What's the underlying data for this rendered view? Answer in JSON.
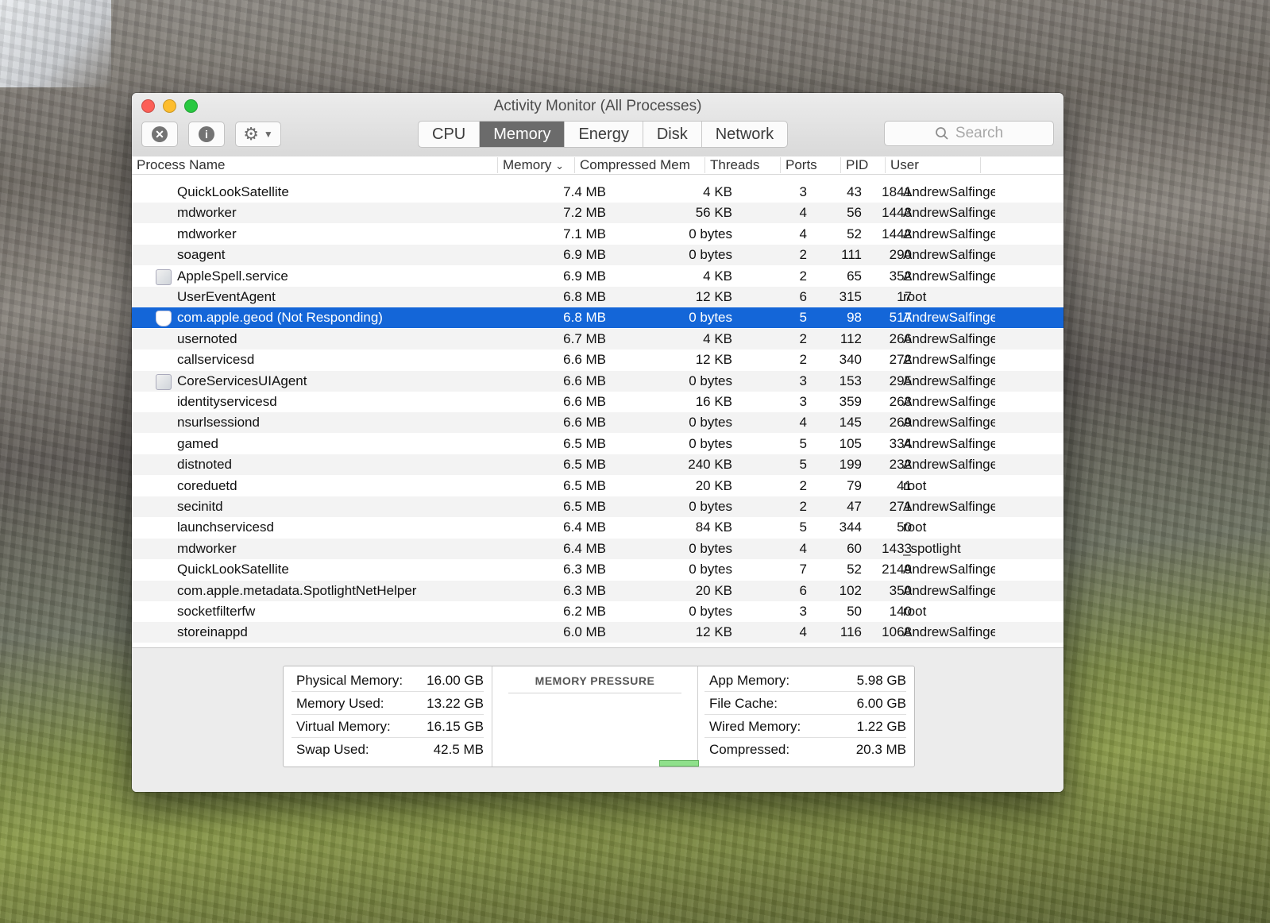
{
  "window": {
    "title": "Activity Monitor (All Processes)"
  },
  "toolbar": {
    "stop_icon": "close-x-icon",
    "info_icon": "info-icon",
    "gear_icon": "gear-icon",
    "tabs": [
      "CPU",
      "Memory",
      "Energy",
      "Disk",
      "Network"
    ],
    "active_tab": "Memory",
    "search_placeholder": "Search"
  },
  "table": {
    "columns": [
      "Process Name",
      "Memory",
      "Compressed Mem",
      "Threads",
      "Ports",
      "PID",
      "User"
    ],
    "sort_indicator": "⌄",
    "rows": [
      {
        "name": "QuickLookSatellite",
        "memory": "7.4 MB",
        "compressed": "4 KB",
        "threads": "3",
        "ports": "43",
        "pid": "1841",
        "user": "AndrewSalfinge"
      },
      {
        "name": "mdworker",
        "memory": "7.2 MB",
        "compressed": "56 KB",
        "threads": "4",
        "ports": "56",
        "pid": "1443",
        "user": "AndrewSalfinge"
      },
      {
        "name": "mdworker",
        "memory": "7.1 MB",
        "compressed": "0 bytes",
        "threads": "4",
        "ports": "52",
        "pid": "1442",
        "user": "AndrewSalfinge"
      },
      {
        "name": "soagent",
        "memory": "6.9 MB",
        "compressed": "0 bytes",
        "threads": "2",
        "ports": "111",
        "pid": "290",
        "user": "AndrewSalfinge"
      },
      {
        "name": "AppleSpell.service",
        "memory": "6.9 MB",
        "compressed": "4 KB",
        "threads": "2",
        "ports": "65",
        "pid": "352",
        "user": "AndrewSalfinge"
      },
      {
        "name": "UserEventAgent",
        "memory": "6.8 MB",
        "compressed": "12 KB",
        "threads": "6",
        "ports": "315",
        "pid": "17",
        "user": "root"
      },
      {
        "name": "com.apple.geod (Not Responding)",
        "memory": "6.8 MB",
        "compressed": "0 bytes",
        "threads": "5",
        "ports": "98",
        "pid": "517",
        "user": "AndrewSalfinge"
      },
      {
        "name": "usernoted",
        "memory": "6.7 MB",
        "compressed": "4 KB",
        "threads": "2",
        "ports": "112",
        "pid": "266",
        "user": "AndrewSalfinge"
      },
      {
        "name": "callservicesd",
        "memory": "6.6 MB",
        "compressed": "12 KB",
        "threads": "2",
        "ports": "340",
        "pid": "272",
        "user": "AndrewSalfinge"
      },
      {
        "name": "CoreServicesUIAgent",
        "memory": "6.6 MB",
        "compressed": "0 bytes",
        "threads": "3",
        "ports": "153",
        "pid": "295",
        "user": "AndrewSalfinge"
      },
      {
        "name": "identityservicesd",
        "memory": "6.6 MB",
        "compressed": "16 KB",
        "threads": "3",
        "ports": "359",
        "pid": "263",
        "user": "AndrewSalfinge"
      },
      {
        "name": "nsurlsessiond",
        "memory": "6.6 MB",
        "compressed": "0 bytes",
        "threads": "4",
        "ports": "145",
        "pid": "269",
        "user": "AndrewSalfinge"
      },
      {
        "name": "gamed",
        "memory": "6.5 MB",
        "compressed": "0 bytes",
        "threads": "5",
        "ports": "105",
        "pid": "334",
        "user": "AndrewSalfinge"
      },
      {
        "name": "distnoted",
        "memory": "6.5 MB",
        "compressed": "240 KB",
        "threads": "5",
        "ports": "199",
        "pid": "232",
        "user": "AndrewSalfinge"
      },
      {
        "name": "coreduetd",
        "memory": "6.5 MB",
        "compressed": "20 KB",
        "threads": "2",
        "ports": "79",
        "pid": "41",
        "user": "root"
      },
      {
        "name": "secinitd",
        "memory": "6.5 MB",
        "compressed": "0 bytes",
        "threads": "2",
        "ports": "47",
        "pid": "271",
        "user": "AndrewSalfinge"
      },
      {
        "name": "launchservicesd",
        "memory": "6.4 MB",
        "compressed": "84 KB",
        "threads": "5",
        "ports": "344",
        "pid": "50",
        "user": "root"
      },
      {
        "name": "mdworker",
        "memory": "6.4 MB",
        "compressed": "0 bytes",
        "threads": "4",
        "ports": "60",
        "pid": "1433",
        "user": "_spotlight"
      },
      {
        "name": "QuickLookSatellite",
        "memory": "6.3 MB",
        "compressed": "0 bytes",
        "threads": "7",
        "ports": "52",
        "pid": "2149",
        "user": "AndrewSalfinge"
      },
      {
        "name": "com.apple.metadata.SpotlightNetHelper",
        "memory": "6.3 MB",
        "compressed": "20 KB",
        "threads": "6",
        "ports": "102",
        "pid": "350",
        "user": "AndrewSalfinge"
      },
      {
        "name": "socketfilterfw",
        "memory": "6.2 MB",
        "compressed": "0 bytes",
        "threads": "3",
        "ports": "50",
        "pid": "140",
        "user": "root"
      },
      {
        "name": "storeinappd",
        "memory": "6.0 MB",
        "compressed": "12 KB",
        "threads": "4",
        "ports": "116",
        "pid": "1068",
        "user": "AndrewSalfinge"
      }
    ],
    "selected_index": 6,
    "icon_rows": {
      "4": "doc",
      "6": "shield",
      "9": "doc"
    }
  },
  "stats": {
    "left": [
      {
        "label": "Physical Memory:",
        "value": "16.00 GB"
      },
      {
        "label": "Memory Used:",
        "value": "13.22 GB"
      },
      {
        "label": "Virtual Memory:",
        "value": "16.15 GB"
      },
      {
        "label": "Swap Used:",
        "value": "42.5 MB"
      }
    ],
    "pressure_title": "MEMORY PRESSURE",
    "right": [
      {
        "label": "App Memory:",
        "value": "5.98 GB"
      },
      {
        "label": "File Cache:",
        "value": "6.00 GB"
      },
      {
        "label": "Wired Memory:",
        "value": "1.22 GB"
      },
      {
        "label": "Compressed:",
        "value": "20.3 MB"
      }
    ]
  }
}
